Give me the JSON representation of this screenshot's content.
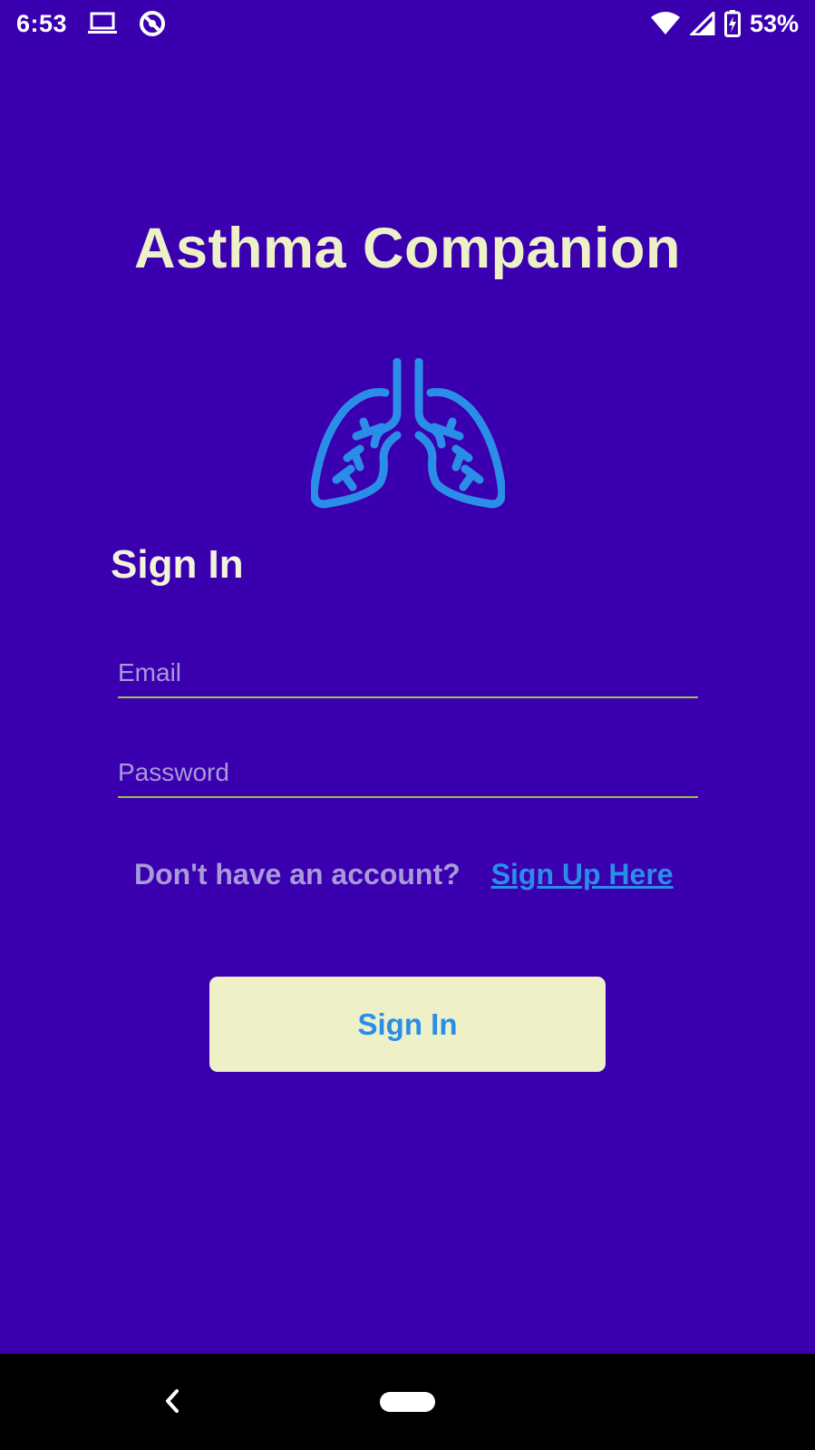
{
  "status_bar": {
    "time": "6:53",
    "battery_percent": "53%",
    "icons": [
      "laptop-icon",
      "sync-icon",
      "wifi-icon",
      "signal-icon",
      "battery-charging-icon"
    ]
  },
  "app": {
    "title": "Asthma Companion",
    "logo_icon": "lungs-icon"
  },
  "form": {
    "heading": "Sign In",
    "email": {
      "value": "",
      "placeholder": "Email"
    },
    "password": {
      "value": "",
      "placeholder": "Password"
    },
    "signup_prompt": "Don't have an account?",
    "signup_link": "Sign Up Here",
    "submit_label": "Sign In"
  },
  "navigation": {
    "back_icon": "back-chevron-icon",
    "home_icon": "home-pill-icon"
  },
  "colors": {
    "background": "#3a00b0",
    "title": "#eef0c8",
    "accent_blue": "#2a8ee8",
    "button_bg": "#eef0c8",
    "field_underline": "#9bc34a",
    "muted_text": "#a99ad8"
  }
}
